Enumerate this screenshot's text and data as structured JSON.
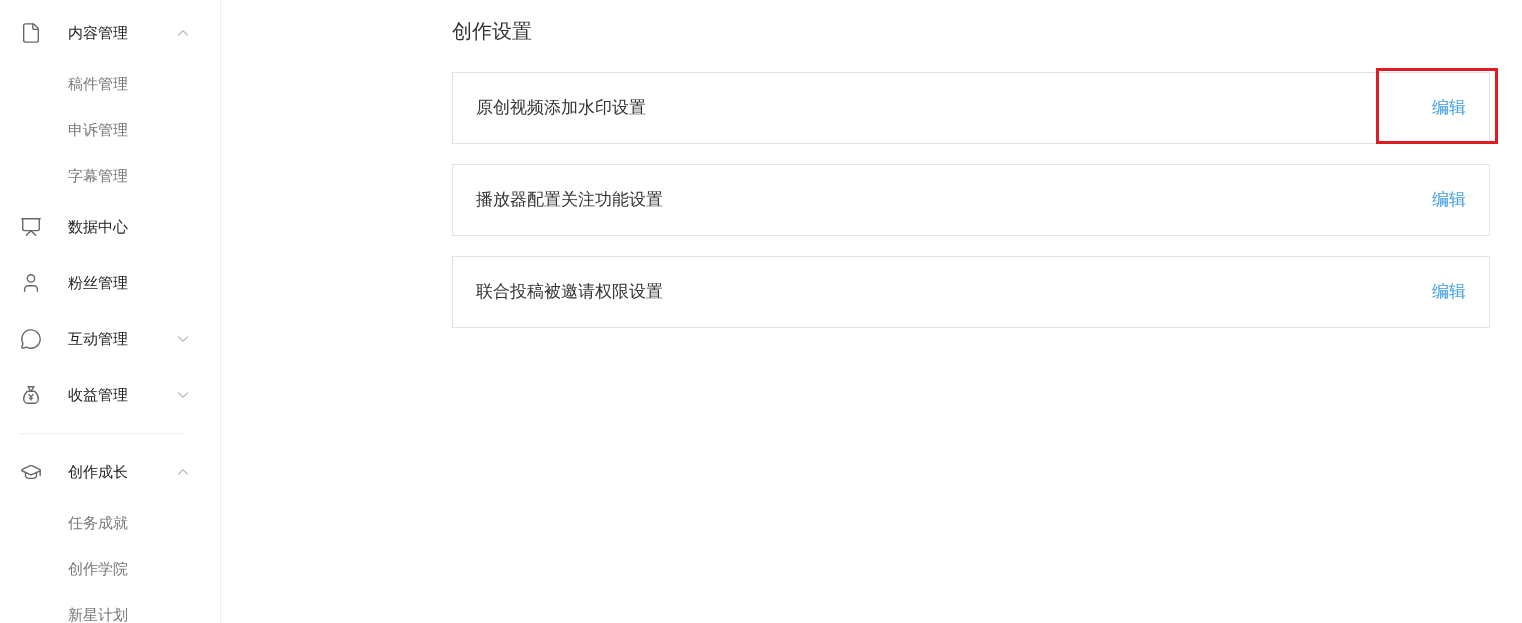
{
  "sidebar": {
    "sections": [
      {
        "items": [
          {
            "label": "内容管理",
            "expanded": true,
            "children": [
              {
                "label": "稿件管理"
              },
              {
                "label": "申诉管理"
              },
              {
                "label": "字幕管理"
              }
            ]
          },
          {
            "label": "数据中心"
          },
          {
            "label": "粉丝管理"
          },
          {
            "label": "互动管理",
            "expanded": false
          },
          {
            "label": "收益管理",
            "expanded": false
          }
        ]
      },
      {
        "items": [
          {
            "label": "创作成长",
            "expanded": true,
            "children": [
              {
                "label": "任务成就"
              },
              {
                "label": "创作学院"
              },
              {
                "label": "新星计划"
              }
            ]
          }
        ]
      }
    ]
  },
  "main": {
    "title": "创作设置",
    "settings": [
      {
        "label": "原创视频添加水印设置",
        "action": "编辑",
        "highlighted": true
      },
      {
        "label": "播放器配置关注功能设置",
        "action": "编辑",
        "highlighted": false
      },
      {
        "label": "联合投稿被邀请权限设置",
        "action": "编辑",
        "highlighted": false
      }
    ]
  }
}
